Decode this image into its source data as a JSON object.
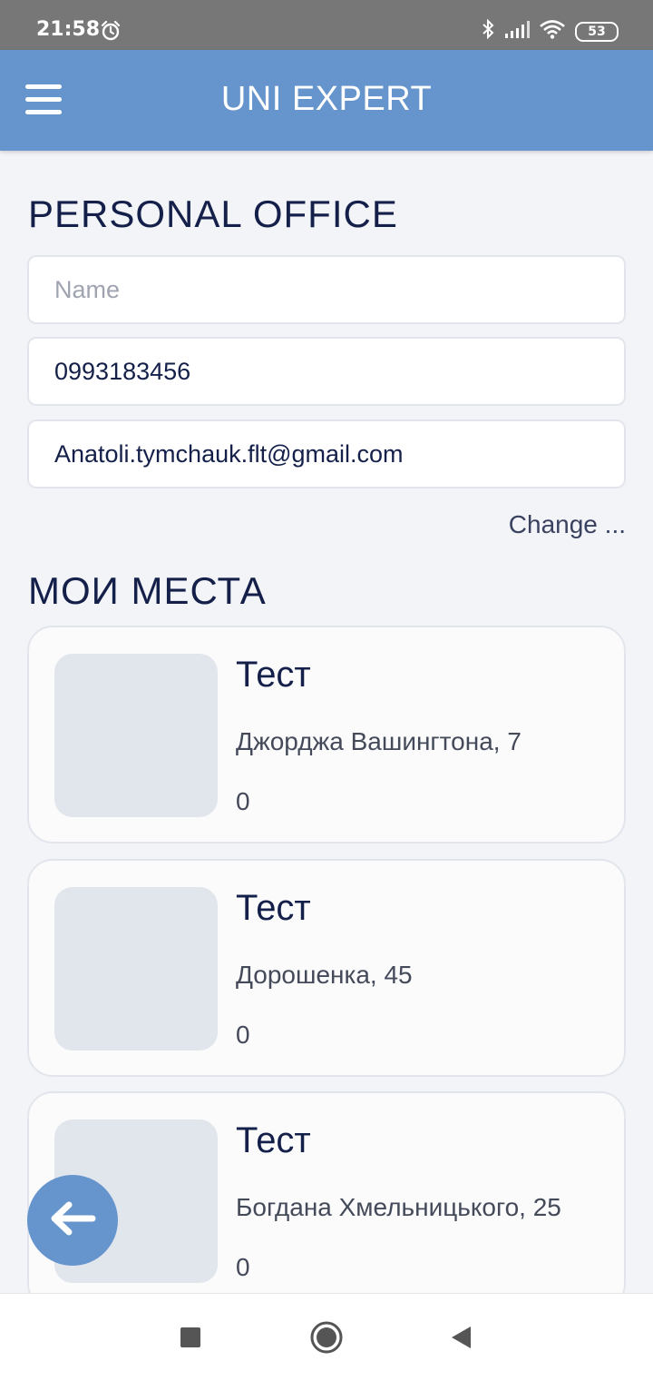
{
  "status_bar": {
    "time": "21:58",
    "battery": "53",
    "icons": [
      "alarm-icon",
      "bluetooth-icon",
      "signal-icon",
      "wifi-icon",
      "battery-icon"
    ]
  },
  "app_bar": {
    "title": "UNI EXPERT",
    "menu_icon": "hamburger-menu-icon"
  },
  "personal_office": {
    "title": "PERSONAL OFFICE",
    "name_placeholder": "Name",
    "name_value": "",
    "phone_value": "0993183456",
    "email_value": "Anatoli.tymchauk.flt@gmail.com",
    "change_label": "Change ..."
  },
  "places": {
    "title": "МОИ МЕСТА",
    "items": [
      {
        "title": "Тест",
        "address": "Джорджа Вашингтона, 7",
        "count": "0"
      },
      {
        "title": "Тест",
        "address": "Дорошенка, 45",
        "count": "0"
      },
      {
        "title": "Тест",
        "address": "Богдана Хмельницького, 25",
        "count": "0"
      }
    ]
  },
  "fab": {
    "icon": "arrow-left-icon"
  },
  "nav_bar": {
    "icons": [
      "recents-square-icon",
      "home-circle-icon",
      "back-triangle-icon"
    ]
  },
  "colors": {
    "accent": "#6595cc",
    "heading": "#14204a",
    "background": "#f3f4f8"
  }
}
